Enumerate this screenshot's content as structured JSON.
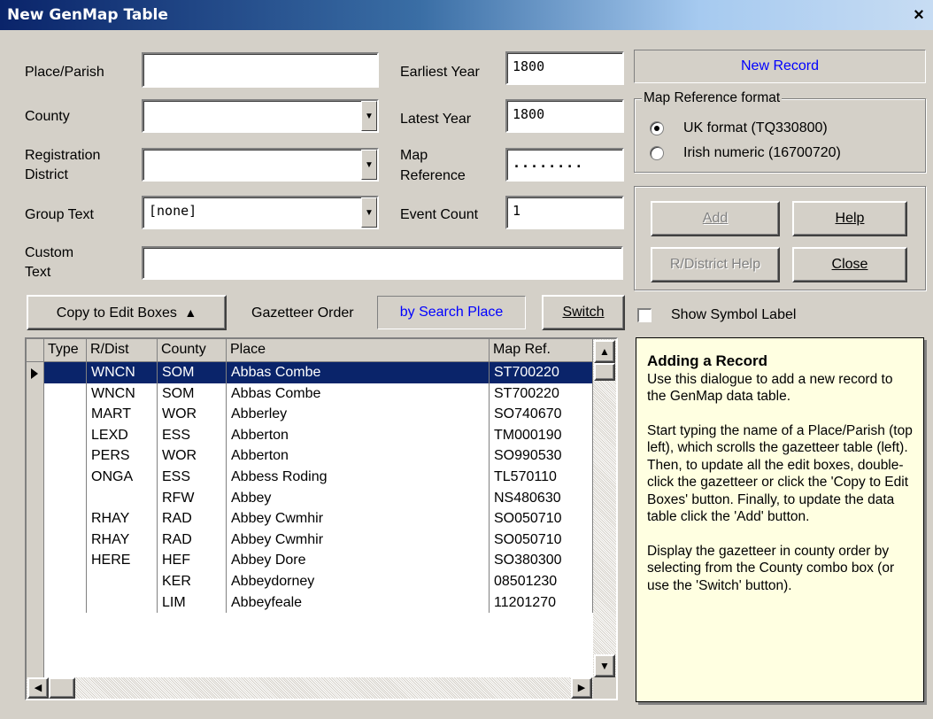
{
  "window": {
    "title": "New GenMap Table",
    "close_glyph": "×"
  },
  "form": {
    "place_parish": {
      "label": "Place/Parish",
      "value": ""
    },
    "county": {
      "label": "County",
      "value": ""
    },
    "registration_district": {
      "label1": "Registration",
      "label2": "District",
      "value": ""
    },
    "group_text": {
      "label": "Group Text",
      "value": "[none]"
    },
    "custom_text": {
      "label1": "Custom",
      "label2": "Text",
      "value": ""
    },
    "earliest_year": {
      "label": "Earliest Year",
      "value": "1800"
    },
    "latest_year": {
      "label": "Latest Year",
      "value": "1800"
    },
    "map_reference": {
      "label1": "Map",
      "label2": "Reference",
      "value": "........"
    },
    "event_count": {
      "label": "Event Count",
      "value": "1"
    }
  },
  "status": {
    "text": "New Record",
    "color": "#0000ff"
  },
  "map_ref_format": {
    "legend": "Map Reference format",
    "options": [
      {
        "label": "UK format (TQ330800)",
        "selected": true
      },
      {
        "label": "Irish numeric (16700720)",
        "selected": false
      }
    ]
  },
  "buttons": {
    "add": "Add",
    "help": "Help",
    "rdistrict_help": "R/District Help",
    "close": "Close",
    "copy_to_edit": "Copy to Edit Boxes",
    "switch": "Switch"
  },
  "gazetteer": {
    "label": "Gazetteer Order",
    "order": "by Search Place"
  },
  "show_symbol_label": {
    "label": "Show Symbol Label",
    "checked": false
  },
  "table": {
    "columns": [
      "Type",
      "R/Dist",
      "County",
      "Place",
      "Map Ref."
    ],
    "rows": [
      {
        "type": "",
        "rdist": "WNCN",
        "county": "SOM",
        "place": "Abbas Combe",
        "mapref": "ST700220",
        "selected": true
      },
      {
        "type": "",
        "rdist": "WNCN",
        "county": "SOM",
        "place": "Abbas Combe",
        "mapref": "ST700220"
      },
      {
        "type": "",
        "rdist": "MART",
        "county": "WOR",
        "place": "Abberley",
        "mapref": "SO740670"
      },
      {
        "type": "",
        "rdist": "LEXD",
        "county": "ESS",
        "place": "Abberton",
        "mapref": "TM000190"
      },
      {
        "type": "",
        "rdist": "PERS",
        "county": "WOR",
        "place": "Abberton",
        "mapref": "SO990530"
      },
      {
        "type": "",
        "rdist": "ONGA",
        "county": "ESS",
        "place": "Abbess Roding",
        "mapref": "TL570110"
      },
      {
        "type": "",
        "rdist": "",
        "county": "RFW",
        "place": "Abbey",
        "mapref": "NS480630"
      },
      {
        "type": "",
        "rdist": "RHAY",
        "county": "RAD",
        "place": "Abbey Cwmhir",
        "mapref": "SO050710"
      },
      {
        "type": "",
        "rdist": "RHAY",
        "county": "RAD",
        "place": "Abbey Cwmhir",
        "mapref": "SO050710"
      },
      {
        "type": "",
        "rdist": "HERE",
        "county": "HEF",
        "place": "Abbey Dore",
        "mapref": "SO380300"
      },
      {
        "type": "",
        "rdist": "",
        "county": "KER",
        "place": "Abbeydorney",
        "mapref": "08501230"
      },
      {
        "type": "",
        "rdist": "",
        "county": "LIM",
        "place": "Abbeyfeale",
        "mapref": "11201270"
      }
    ]
  },
  "note": {
    "title": "Adding a Record",
    "p1": "Use this dialogue to add a new record to the GenMap data table.",
    "p2": "Start typing the name of a Place/Parish (top left), which scrolls the gazetteer table (left).  Then, to update all the edit boxes, double-click the gazetteer or click the 'Copy to Edit Boxes' button.  Finally, to update the data table click the 'Add' button.",
    "p3": "Display the gazetteer in county order by selecting from the County combo box (or use the 'Switch' button)."
  }
}
